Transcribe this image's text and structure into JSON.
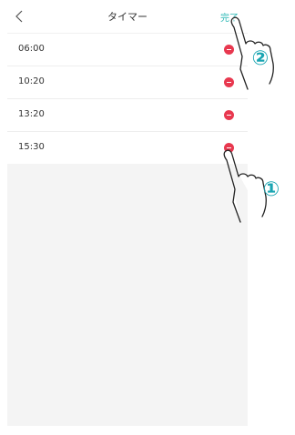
{
  "header": {
    "title": "タイマー",
    "done_label": "完了"
  },
  "timers": [
    {
      "time": "06:00"
    },
    {
      "time": "10:20"
    },
    {
      "time": "13:20"
    },
    {
      "time": "15:30"
    }
  ],
  "annotations": {
    "step1": "①",
    "step2": "②"
  },
  "colors": {
    "accent": "#2ab7b4",
    "delete": "#e8384f",
    "annotation": "#1aa5b2"
  },
  "icons": {
    "back": "chevron-left-icon",
    "delete": "minus-circle-icon",
    "pointer": "pointing-hand-icon"
  }
}
